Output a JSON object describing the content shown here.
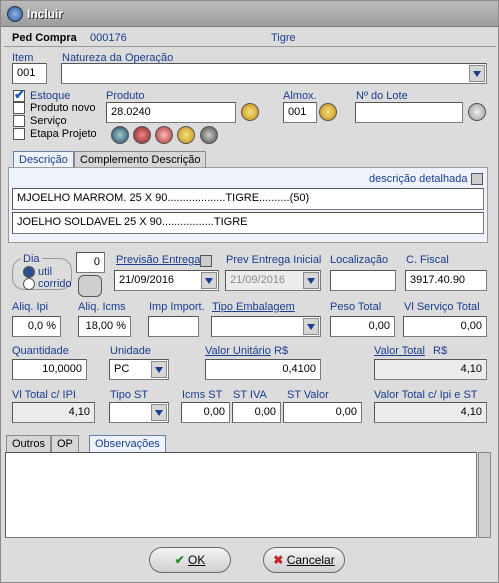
{
  "window": {
    "title": "Incluir"
  },
  "header": {
    "doc_type": "Ped Compra",
    "doc_number": "000176",
    "supplier": "Tigre"
  },
  "item": {
    "label": "Item",
    "value": "001"
  },
  "natureza": {
    "label": "Natureza da Operação",
    "value": ""
  },
  "flags": [
    {
      "label": "Estoque",
      "checked": true
    },
    {
      "label": "Produto novo",
      "checked": false
    },
    {
      "label": "Serviço",
      "checked": false
    },
    {
      "label": "Etapa Projeto",
      "checked": false
    }
  ],
  "produto": {
    "label": "Produto",
    "value": "28.0240"
  },
  "almox": {
    "label": "Almox.",
    "value": "001"
  },
  "lote": {
    "label": "Nº do Lote",
    "value": ""
  },
  "tabs_top": [
    "Descrição",
    "Complemento Descrição"
  ],
  "descricao": {
    "detail_label": "descrição detalhada",
    "line1": "MJOELHO MARROM. 25 X 90...................TIGRE..........(50)",
    "line2": "JOELHO SOLDAVEL 25 X 90.................TIGRE"
  },
  "dia": {
    "label": "Dia",
    "value": "0",
    "opt_util": "util",
    "opt_corrido": "corrido"
  },
  "previsao": {
    "label": "Previsão Entrega",
    "value": "21/09/2016"
  },
  "prev_inicial": {
    "label": "Prev Entrega Inicial",
    "value": "21/09/2016"
  },
  "localizacao": {
    "label": "Localização",
    "value": ""
  },
  "cfiscal": {
    "label": "C. Fiscal",
    "value": "3917.40.90"
  },
  "aliq_ipi": {
    "label": "Aliq. Ipi",
    "value": "0,0 %"
  },
  "aliq_icms": {
    "label": "Aliq. Icms",
    "value": "18,00 %"
  },
  "imp_import": {
    "label": "Imp Import.",
    "value": ""
  },
  "tipo_emb": {
    "label": "Tipo Embalagem",
    "value": ""
  },
  "peso_total": {
    "label": "Peso Total",
    "value": "0,00"
  },
  "vl_servico": {
    "label": "Vl Serviço Total",
    "value": "0,00"
  },
  "quantidade": {
    "label": "Quantidade",
    "value": "10,0000"
  },
  "unidade": {
    "label": "Unidade",
    "value": "PC"
  },
  "valor_unit": {
    "label": "Valor Unitário",
    "currency": "R$",
    "value": "0,4100"
  },
  "valor_total": {
    "label": "Valor Total",
    "currency": "R$",
    "value": "4,10"
  },
  "vl_total_ipi": {
    "label": "Vl Total c/ IPI",
    "value": "4,10"
  },
  "tipo_st": {
    "label": "Tipo ST",
    "value": ""
  },
  "icms_st": {
    "label": "Icms ST",
    "value": "0,00"
  },
  "st_iva": {
    "label": "ST IVA",
    "value": "0,00"
  },
  "st_valor": {
    "label": "ST Valor",
    "value": "0,00"
  },
  "valor_total_ipi_st": {
    "label": "Valor Total c/ Ipi e ST",
    "value": "4,10"
  },
  "tabs_bottom": [
    "Outros",
    "OP",
    "Observações"
  ],
  "buttons": {
    "ok": "OK",
    "cancel": "Cancelar"
  }
}
